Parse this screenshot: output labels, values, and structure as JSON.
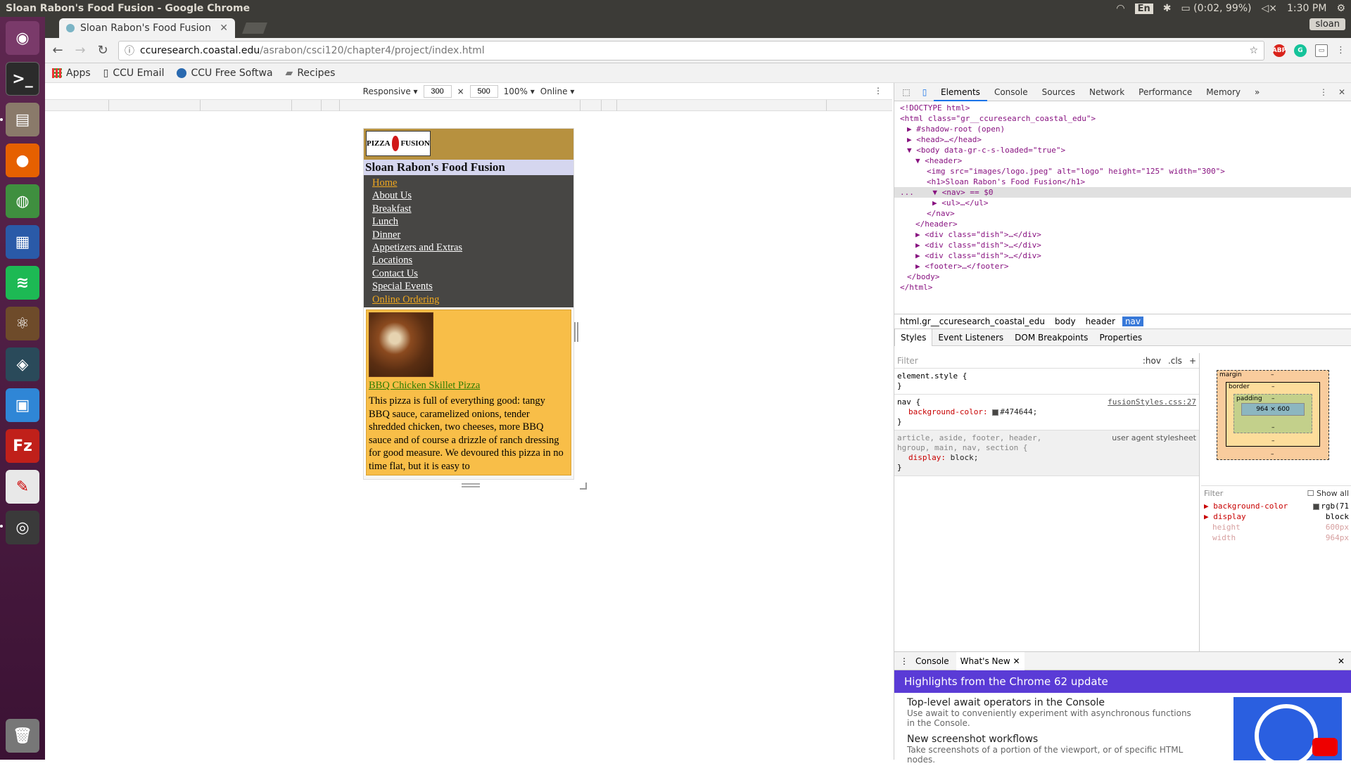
{
  "os": {
    "window_title": "Sloan Rabon's Food Fusion - Google Chrome",
    "keyboard": "En",
    "battery": "(0:02, 99%)",
    "clock": "1:30 PM"
  },
  "browser": {
    "tab_title": "Sloan Rabon's Food Fusion",
    "profile": "sloan",
    "url_host": "ccuresearch.coastal.edu",
    "url_path": "/asrabon/csci120/chapter4/project/index.html",
    "bookmarks": [
      "Apps",
      "CCU Email",
      "CCU Free Softwa",
      "Recipes"
    ],
    "ext_abp": "ABP"
  },
  "device_toolbar": {
    "mode": "Responsive",
    "width": "300",
    "height": "500",
    "zoom": "100%",
    "network": "Online",
    "times": "×"
  },
  "site": {
    "logo_text_a": "PIZZA",
    "logo_text_b": "FUSION",
    "title": "Sloan Rabon's Food Fusion",
    "nav": [
      "Home",
      "About Us",
      "Breakfast",
      "Lunch",
      "Dinner",
      "Appetizers and Extras",
      "Locations",
      "Contact Us",
      "Special Events",
      "Online Ordering"
    ],
    "dish_title": "BBQ Chicken Skillet Pizza",
    "dish_desc": "This pizza is full of everything good: tangy BBQ sauce, caramelized onions, tender shredded chicken, two cheeses, more BBQ sauce and of course a drizzle of ranch dressing for good measure. We devoured this pizza in no time flat, but it is easy to"
  },
  "devtools": {
    "tabs": [
      "Elements",
      "Console",
      "Sources",
      "Network",
      "Performance",
      "Memory"
    ],
    "more": "»",
    "dom": {
      "doctype": "<!DOCTYPE html>",
      "html_open": "<html class=\"gr__ccuresearch_coastal_edu\">",
      "shadow": "#shadow-root (open)",
      "head": "<head>…</head>",
      "body_open": "<body data-gr-c-s-loaded=\"true\">",
      "header_open": "<header>",
      "img": "<img src=\"images/logo.jpeg\" alt=\"logo\" height=\"125\" width=\"300\">",
      "h1": "<h1>Sloan Rabon's Food Fusion</h1>",
      "nav_open": "<nav> == $0",
      "ul": "<ul>…</ul>",
      "nav_close": "</nav>",
      "header_close": "</header>",
      "div": "<div class=\"dish\">…</div>",
      "footer": "<footer>…</footer>",
      "body_close": "</body>",
      "html_close": "</html>",
      "ellipsis": "..."
    },
    "breadcrumbs": [
      "html.gr__ccuresearch_coastal_edu",
      "body",
      "header",
      "nav"
    ],
    "subtabs": [
      "Styles",
      "Event Listeners",
      "DOM Breakpoints",
      "Properties"
    ],
    "filter_placeholder": "Filter",
    "hov": ":hov",
    "cls": ".cls",
    "rules": {
      "element_style": "element.style {",
      "close": "}",
      "nav_selector": "nav {",
      "nav_source": "fusionStyles.css:27",
      "nav_prop": "background-color:",
      "nav_val": "#474644;",
      "ua_selector": "article, aside, footer, header, hgroup, main, nav, section {",
      "ua_source": "user agent stylesheet",
      "ua_prop": "display:",
      "ua_val": "block;"
    },
    "box_model": {
      "margin": "margin",
      "border": "border",
      "padding": "padding",
      "content": "964 × 600",
      "dash": "–"
    },
    "computed": {
      "filter": "Filter",
      "show_all": "Show all",
      "rows": [
        {
          "k": "background-color",
          "v": "rgb(71"
        },
        {
          "k": "display",
          "v": "block"
        },
        {
          "k": "height",
          "v": "600px"
        },
        {
          "k": "width",
          "v": "964px"
        }
      ]
    },
    "drawer": {
      "tabs": [
        "Console",
        "What's New"
      ],
      "banner": "Highlights from the Chrome 62 update",
      "items": [
        {
          "h": "Top-level await operators in the Console",
          "d": "Use await to conveniently experiment with asynchronous functions in the Console."
        },
        {
          "h": "New screenshot workflows",
          "d": "Take screenshots of a portion of the viewport, or of specific HTML nodes."
        }
      ]
    }
  }
}
